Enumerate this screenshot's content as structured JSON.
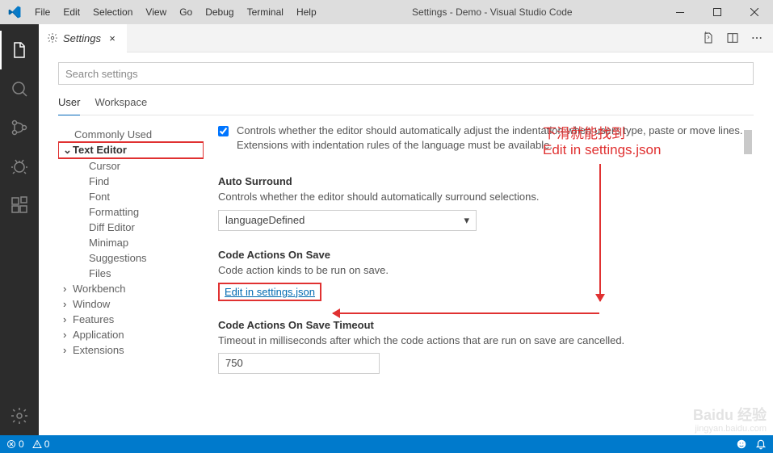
{
  "window": {
    "title": "Settings - Demo - Visual Studio Code",
    "menus": [
      "File",
      "Edit",
      "Selection",
      "View",
      "Go",
      "Debug",
      "Terminal",
      "Help"
    ]
  },
  "tab": {
    "label": "Settings"
  },
  "search": {
    "placeholder": "Search settings"
  },
  "scope": {
    "user": "User",
    "workspace": "Workspace"
  },
  "toc": {
    "commonly_used": "Commonly Used",
    "text_editor": "Text Editor",
    "children": [
      "Cursor",
      "Find",
      "Font",
      "Formatting",
      "Diff Editor",
      "Minimap",
      "Suggestions",
      "Files"
    ],
    "workbench": "Workbench",
    "window": "Window",
    "features": "Features",
    "application": "Application",
    "extensions": "Extensions"
  },
  "settings": {
    "autoIndent": {
      "desc": "Controls whether the editor should automatically adjust the indentation when users type, paste or move lines. Extensions with indentation rules of the language must be available."
    },
    "autoSurround": {
      "title": "Auto Surround",
      "desc": "Controls whether the editor should automatically surround selections.",
      "value": "languageDefined"
    },
    "codeActionsOnSave": {
      "title": "Code Actions On Save",
      "desc": "Code action kinds to be run on save.",
      "link": "Edit in settings.json"
    },
    "codeActionsTimeout": {
      "title": "Code Actions On Save Timeout",
      "desc": "Timeout in milliseconds after which the code actions that are run on save are cancelled.",
      "value": "750"
    }
  },
  "annotations": {
    "line1": "下滑就能找到",
    "line2": "Edit in settings.json"
  },
  "statusbar": {
    "errors": "0",
    "warnings": "0"
  },
  "watermark": {
    "l1": "Baidu 经验",
    "l2": "jingyan.baidu.com"
  }
}
